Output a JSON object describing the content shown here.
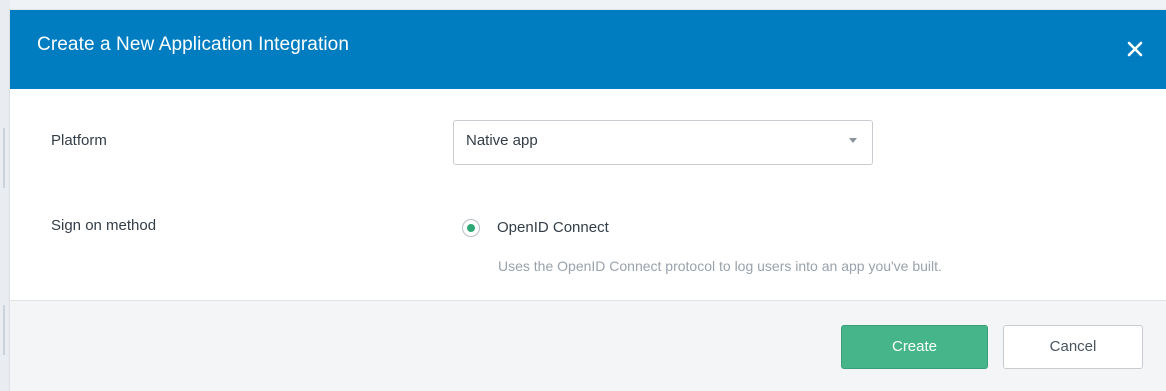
{
  "dialog": {
    "title": "Create a New Application Integration",
    "close_icon": "close-icon"
  },
  "form": {
    "platform": {
      "label": "Platform",
      "selected_value": "Native app",
      "caret_icon": "caret-down-icon"
    },
    "sign_on": {
      "label": "Sign on method",
      "option_label": "OpenID Connect",
      "option_help": "Uses the OpenID Connect protocol to log users into an app you've built.",
      "selected": true
    }
  },
  "footer": {
    "create_label": "Create",
    "cancel_label": "Cancel"
  },
  "colors": {
    "header": "#007dc1",
    "primary_button": "#46b68a",
    "radio_selected": "#2fa876"
  }
}
